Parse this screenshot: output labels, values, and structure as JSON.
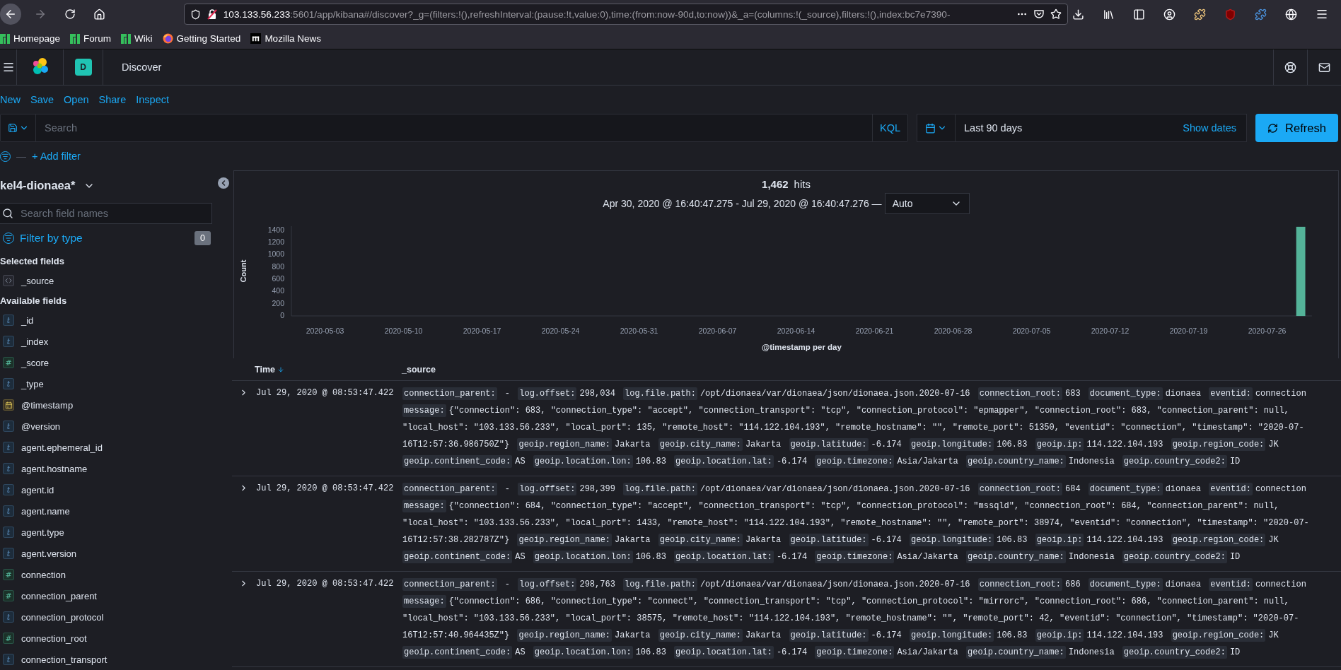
{
  "browser": {
    "url_host": "103.133.56.233",
    "url_rest": ":5601/app/kibana#/discover?_g=(filters:!(),refreshInterval:(pause:!t,value:0),time:(from:now-90d,to:now))&_a=(columns:!(_source),filters:!(),index:bc7e7390-",
    "bookmarks": [
      {
        "label": "Homepage",
        "kind": "manjaro"
      },
      {
        "label": "Forum",
        "kind": "manjaro"
      },
      {
        "label": "Wiki",
        "kind": "manjaro"
      },
      {
        "label": "Getting Started",
        "kind": "firefox"
      },
      {
        "label": "Mozilla News",
        "kind": "mozilla"
      }
    ]
  },
  "header": {
    "space_badge": "D",
    "title": "Discover"
  },
  "top_nav": [
    "New",
    "Save",
    "Open",
    "Share",
    "Inspect"
  ],
  "query_bar": {
    "placeholder": "Search",
    "language": "KQL",
    "time_range": "Last 90 days",
    "show_dates": "Show dates",
    "refresh": "Refresh"
  },
  "filter_bar": {
    "separator": "—",
    "add_filter": "+ Add filter"
  },
  "sidebar": {
    "index_pattern": "kel4-dionaea*",
    "search_placeholder": "Search field names",
    "filter_by_type": "Filter by type",
    "filter_count": "0",
    "selected_heading": "Selected fields",
    "selected_fields": [
      {
        "name": "_source",
        "kind": "source"
      }
    ],
    "available_heading": "Available fields",
    "available_fields": [
      {
        "name": "_id",
        "kind": "string",
        "glyph": "t"
      },
      {
        "name": "_index",
        "kind": "string",
        "glyph": "t"
      },
      {
        "name": "_score",
        "kind": "number",
        "glyph": "#"
      },
      {
        "name": "_type",
        "kind": "string",
        "glyph": "t"
      },
      {
        "name": "@timestamp",
        "kind": "date"
      },
      {
        "name": "@version",
        "kind": "string",
        "glyph": "t"
      },
      {
        "name": "agent.ephemeral_id",
        "kind": "string",
        "glyph": "t"
      },
      {
        "name": "agent.hostname",
        "kind": "string",
        "glyph": "t"
      },
      {
        "name": "agent.id",
        "kind": "string",
        "glyph": "t"
      },
      {
        "name": "agent.name",
        "kind": "string",
        "glyph": "t"
      },
      {
        "name": "agent.type",
        "kind": "string",
        "glyph": "t"
      },
      {
        "name": "agent.version",
        "kind": "string",
        "glyph": "t"
      },
      {
        "name": "connection",
        "kind": "number",
        "glyph": "#"
      },
      {
        "name": "connection_parent",
        "kind": "number",
        "glyph": "#"
      },
      {
        "name": "connection_protocol",
        "kind": "string",
        "glyph": "t"
      },
      {
        "name": "connection_root",
        "kind": "number",
        "glyph": "#"
      },
      {
        "name": "connection_transport",
        "kind": "string",
        "glyph": "t"
      }
    ]
  },
  "histogram": {
    "hits": "1,462",
    "hits_label": "hits",
    "range": "Apr 30, 2020 @ 16:40:47.275 - Jul 29, 2020 @ 16:40:47.276 —",
    "interval": "Auto",
    "chart_data": {
      "type": "bar",
      "xlabel": "@timestamp per day",
      "ylabel": "Count",
      "x": [
        "2020-07-29"
      ],
      "values": [
        1460
      ],
      "xlim": [
        "2020-04-30",
        "2020-07-30"
      ],
      "ylim": [
        0,
        1470
      ],
      "xticks": [
        "2020-05-03",
        "2020-05-10",
        "2020-05-17",
        "2020-05-24",
        "2020-05-31",
        "2020-06-07",
        "2020-06-14",
        "2020-06-21",
        "2020-06-28",
        "2020-07-05",
        "2020-07-12",
        "2020-07-19",
        "2020-07-26"
      ],
      "yticks": [
        0,
        200,
        400,
        600,
        800,
        1000,
        1200,
        1400
      ]
    }
  },
  "table": {
    "columns": [
      {
        "label": "Time",
        "sorted": true
      },
      {
        "label": "_source",
        "sorted": false
      }
    ],
    "rows": [
      {
        "time": "Jul 29, 2020 @ 08:53:47.422",
        "fields": [
          {
            "key": "connection_parent:",
            "value": " - "
          },
          {
            "key": "log.offset:",
            "value": "298,034"
          },
          {
            "key": "log.file.path:",
            "value": "/opt/dionaea/var/dionaea/json/dionaea.json.2020-07-16"
          },
          {
            "key": "connection_root:",
            "value": "683"
          },
          {
            "key": "document_type:",
            "value": "dionaea"
          },
          {
            "key": "eventid:",
            "value": "connection"
          },
          {
            "key": "message:",
            "value": "{\"connection\": 683, \"connection_type\": \"accept\", \"connection_transport\": \"tcp\", \"connection_protocol\": \"epmapper\", \"connection_root\": 683, \"connection_parent\": null, \"local_host\": \"103.133.56.233\", \"local_port\": 135, \"remote_host\": \"114.122.104.193\", \"remote_hostname\": \"\", \"remote_port\": 51350, \"eventid\": \"connection\", \"timestamp\": \"2020-07-16T12:57:36.986750Z\"}"
          },
          {
            "key": "geoip.region_name:",
            "value": "Jakarta"
          },
          {
            "key": "geoip.city_name:",
            "value": "Jakarta"
          },
          {
            "key": "geoip.latitude:",
            "value": "-6.174"
          },
          {
            "key": "geoip.longitude:",
            "value": "106.83"
          },
          {
            "key": "geoip.ip:",
            "value": "114.122.104.193"
          },
          {
            "key": "geoip.region_code:",
            "value": "JK"
          },
          {
            "key": "geoip.continent_code:",
            "value": "AS"
          },
          {
            "key": "geoip.location.lon:",
            "value": "106.83"
          },
          {
            "key": "geoip.location.lat:",
            "value": "-6.174"
          },
          {
            "key": "geoip.timezone:",
            "value": "Asia/Jakarta"
          },
          {
            "key": "geoip.country_name:",
            "value": "Indonesia"
          },
          {
            "key": "geoip.country_code2:",
            "value": "ID"
          }
        ]
      },
      {
        "time": "Jul 29, 2020 @ 08:53:47.422",
        "fields": [
          {
            "key": "connection_parent:",
            "value": " - "
          },
          {
            "key": "log.offset:",
            "value": "298,399"
          },
          {
            "key": "log.file.path:",
            "value": "/opt/dionaea/var/dionaea/json/dionaea.json.2020-07-16"
          },
          {
            "key": "connection_root:",
            "value": "684"
          },
          {
            "key": "document_type:",
            "value": "dionaea"
          },
          {
            "key": "eventid:",
            "value": "connection"
          },
          {
            "key": "message:",
            "value": "{\"connection\": 684, \"connection_type\": \"accept\", \"connection_transport\": \"tcp\", \"connection_protocol\": \"mssqld\", \"connection_root\": 684, \"connection_parent\": null, \"local_host\": \"103.133.56.233\", \"local_port\": 1433, \"remote_host\": \"114.122.104.193\", \"remote_hostname\": \"\", \"remote_port\": 38974, \"eventid\": \"connection\", \"timestamp\": \"2020-07-16T12:57:38.282787Z\"}"
          },
          {
            "key": "geoip.region_name:",
            "value": "Jakarta"
          },
          {
            "key": "geoip.city_name:",
            "value": "Jakarta"
          },
          {
            "key": "geoip.latitude:",
            "value": "-6.174"
          },
          {
            "key": "geoip.longitude:",
            "value": "106.83"
          },
          {
            "key": "geoip.ip:",
            "value": "114.122.104.193"
          },
          {
            "key": "geoip.region_code:",
            "value": "JK"
          },
          {
            "key": "geoip.continent_code:",
            "value": "AS"
          },
          {
            "key": "geoip.location.lon:",
            "value": "106.83"
          },
          {
            "key": "geoip.location.lat:",
            "value": "-6.174"
          },
          {
            "key": "geoip.timezone:",
            "value": "Asia/Jakarta"
          },
          {
            "key": "geoip.country_name:",
            "value": "Indonesia"
          },
          {
            "key": "geoip.country_code2:",
            "value": "ID"
          }
        ]
      },
      {
        "time": "Jul 29, 2020 @ 08:53:47.422",
        "fields": [
          {
            "key": "connection_parent:",
            "value": " - "
          },
          {
            "key": "log.offset:",
            "value": "298,763"
          },
          {
            "key": "log.file.path:",
            "value": "/opt/dionaea/var/dionaea/json/dionaea.json.2020-07-16"
          },
          {
            "key": "connection_root:",
            "value": "686"
          },
          {
            "key": "document_type:",
            "value": "dionaea"
          },
          {
            "key": "eventid:",
            "value": "connection"
          },
          {
            "key": "message:",
            "value": "{\"connection\": 686, \"connection_type\": \"connect\", \"connection_transport\": \"tcp\", \"connection_protocol\": \"mirrorc\", \"connection_root\": 686, \"connection_parent\": null, \"local_host\": \"103.133.56.233\", \"local_port\": 38575, \"remote_host\": \"114.122.104.193\", \"remote_hostname\": \"\", \"remote_port\": 42, \"eventid\": \"connection\", \"timestamp\": \"2020-07-16T12:57:40.964435Z\"}"
          },
          {
            "key": "geoip.region_name:",
            "value": "Jakarta"
          },
          {
            "key": "geoip.city_name:",
            "value": "Jakarta"
          },
          {
            "key": "geoip.latitude:",
            "value": "-6.174"
          },
          {
            "key": "geoip.longitude:",
            "value": "106.83"
          },
          {
            "key": "geoip.ip:",
            "value": "114.122.104.193"
          },
          {
            "key": "geoip.region_code:",
            "value": "JK"
          },
          {
            "key": "geoip.continent_code:",
            "value": "AS"
          },
          {
            "key": "geoip.location.lon:",
            "value": "106.83"
          },
          {
            "key": "geoip.location.lat:",
            "value": "-6.174"
          },
          {
            "key": "geoip.timezone:",
            "value": "Asia/Jakarta"
          },
          {
            "key": "geoip.country_name:",
            "value": "Indonesia"
          },
          {
            "key": "geoip.country_code2:",
            "value": "ID"
          }
        ]
      }
    ]
  }
}
